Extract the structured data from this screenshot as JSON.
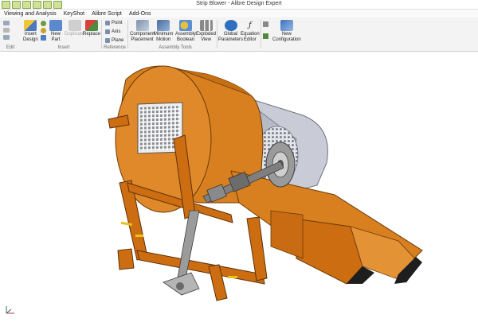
{
  "window": {
    "title": "Strip Blower - Alibre Design Expert"
  },
  "menu": [
    "Viewing and Analysis",
    "KeyShot",
    "Alibre Script",
    "Add-Ons"
  ],
  "ribbon": {
    "insert_design": "Insert\nDesign",
    "new_part": "New\nPart",
    "duplicate": "Duplicate",
    "replace": "Replace",
    "point": "Point",
    "axis": "Axis",
    "plane": "Plane",
    "component_placement": "Component\nPlacement",
    "minimum_motion": "Minimum\nMotion",
    "assembly_boolean": "Assembly\nBoolean",
    "exploded_view": "Exploded\nView",
    "global_parameters": "Global\nParameters",
    "equation_editor": "Equation\nEditor",
    "new_configuration": "New\nConfiguration",
    "groups": {
      "edit": "Edit",
      "insert": "Insert",
      "reference": "Reference",
      "assembly_tools": "Assembly Tools"
    }
  },
  "colors": {
    "housing_orange": "#d8801f",
    "frame_orange": "#cc6d12",
    "guard_grey": "#c9ccd6",
    "steel": "#8c8c8c"
  },
  "icons": [
    "insert-design-icon",
    "new-part-icon",
    "duplicate-icon",
    "replace-icon",
    "component-placement-icon",
    "minimum-motion-icon",
    "assembly-boolean-icon",
    "exploded-view-icon",
    "global-parameters-icon",
    "equation-editor-icon",
    "new-configuration-icon"
  ]
}
